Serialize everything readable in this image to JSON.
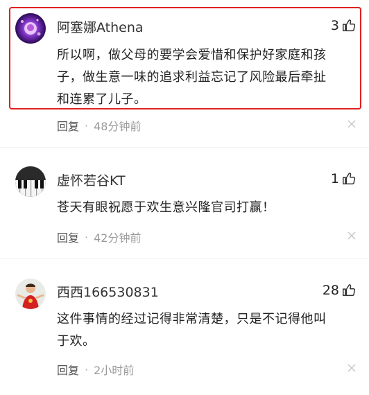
{
  "comments": [
    {
      "username": "阿塞娜Athena",
      "likes": "3",
      "text_lines": [
        "所以啊，做父母的要学会爱惜和保护好家庭和孩",
        "子，做生意一味的追求利益忘记了风险最后牵扯",
        "和连累了儿子。"
      ],
      "reply_label": "回复",
      "separator": "·",
      "time": "48分钟前"
    },
    {
      "username": "虚怀若谷KT",
      "likes": "1",
      "text_lines": [
        "苍天有眼祝愿于欢生意兴隆官司打赢！"
      ],
      "reply_label": "回复",
      "separator": "·",
      "time": "42分钟前"
    },
    {
      "username": "西西166530831",
      "likes": "28",
      "text_lines": [
        "这件事情的经过记得非常清楚，只是不记得他叫",
        "于欢。"
      ],
      "reply_label": "回复",
      "separator": "·",
      "time": "2小时前"
    }
  ],
  "colors": {
    "highlight_border": "#e02020",
    "meta_text": "#999999",
    "body_text": "#222222"
  },
  "icons": {
    "like": "thumbs-up-icon",
    "dismiss": "close-icon"
  }
}
